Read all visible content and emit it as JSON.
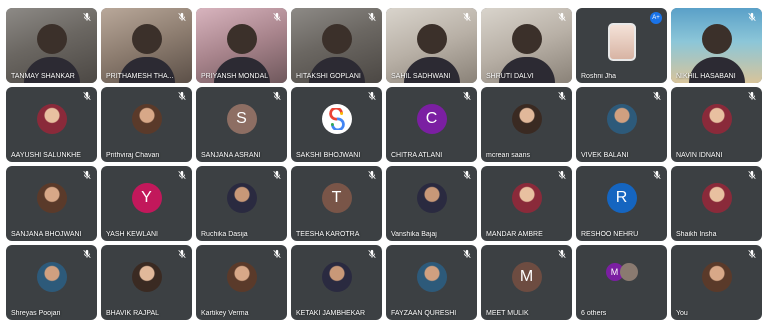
{
  "participants": [
    {
      "name": "TANMAY SHANKAR",
      "type": "video",
      "style": "",
      "muted": true
    },
    {
      "name": "PRITHAMESH THA...",
      "type": "video",
      "style": "warm",
      "muted": true
    },
    {
      "name": "PRIYANSH MONDAL",
      "type": "video",
      "style": "pink",
      "muted": true
    },
    {
      "name": "HITAKSHI GOPLANI",
      "type": "video",
      "style": "",
      "muted": true
    },
    {
      "name": "SAHIL SADHWANI",
      "type": "video",
      "style": "light",
      "muted": true
    },
    {
      "name": "SHRUTI DALVI",
      "type": "video",
      "style": "light",
      "muted": true
    },
    {
      "name": "Roshni Jha",
      "type": "phone",
      "muted": false,
      "badge": "A+"
    },
    {
      "name": "NIKHIL HASABANI",
      "type": "video",
      "style": "beach",
      "muted": true
    },
    {
      "name": "AAYUSHI SALUNKHE",
      "type": "photo",
      "variant": "d",
      "muted": true
    },
    {
      "name": "Prithviraj Chavan",
      "type": "photo",
      "variant": "b",
      "muted": true
    },
    {
      "name": "SANJANA ASRANI",
      "type": "letter",
      "letter": "S",
      "color": "#8d6e63",
      "muted": true
    },
    {
      "name": "SAKSHI BHOJWANI",
      "type": "logo",
      "muted": true
    },
    {
      "name": "CHITRA ATLANI",
      "type": "letter",
      "letter": "C",
      "color": "#7b1fa2",
      "muted": true
    },
    {
      "name": "mcrean saans",
      "type": "photo",
      "variant": "",
      "muted": true
    },
    {
      "name": "VIVEK BALANI",
      "type": "photo",
      "variant": "e",
      "muted": true
    },
    {
      "name": "NAVIN IDNANI",
      "type": "photo",
      "variant": "d",
      "muted": true
    },
    {
      "name": "SANJANA BHOJWANI",
      "type": "photo",
      "variant": "b",
      "muted": true
    },
    {
      "name": "YASH KEWLANI",
      "type": "letter",
      "letter": "Y",
      "color": "#c2185b",
      "muted": true
    },
    {
      "name": "Ruchika Dasija",
      "type": "photo",
      "variant": "c",
      "muted": true
    },
    {
      "name": "TEESHA KAROTRA",
      "type": "letter",
      "letter": "T",
      "color": "#795548",
      "muted": true
    },
    {
      "name": "Vanshika Bajaj",
      "type": "photo",
      "variant": "c",
      "muted": true
    },
    {
      "name": "MANDAR AMBRE",
      "type": "photo",
      "variant": "d",
      "muted": true
    },
    {
      "name": "RESHOO NEHRU",
      "type": "letter",
      "letter": "R",
      "color": "#1565c0",
      "muted": true
    },
    {
      "name": "Shaikh Insha",
      "type": "photo",
      "variant": "d",
      "muted": true
    },
    {
      "name": "Shreyas Poojari",
      "type": "photo",
      "variant": "e",
      "muted": true
    },
    {
      "name": "BHAVIK RAJPAL",
      "type": "photo",
      "variant": "",
      "muted": true
    },
    {
      "name": "Kartikey Verma",
      "type": "photo",
      "variant": "b",
      "muted": true
    },
    {
      "name": "KETAKI JAMBHEKAR",
      "type": "photo",
      "variant": "c",
      "muted": true
    },
    {
      "name": "FAYZAAN QURESHI",
      "type": "photo",
      "variant": "e",
      "muted": true
    },
    {
      "name": "MEET MULIK",
      "type": "letter",
      "letter": "M",
      "color": "#6d4c41",
      "muted": true
    },
    {
      "name": "6 others",
      "type": "others",
      "letters": [
        "M",
        ""
      ],
      "muted": false
    },
    {
      "name": "You",
      "type": "photo",
      "variant": "b",
      "muted": true
    }
  ],
  "colors": {
    "tile_bg": "#3c4043",
    "mic_muted": "#ffffff",
    "text": "#ffffff",
    "badge": "#1a73e8"
  },
  "icons": {
    "muted": "mic-off-icon",
    "badge": "captions-badge-icon"
  }
}
